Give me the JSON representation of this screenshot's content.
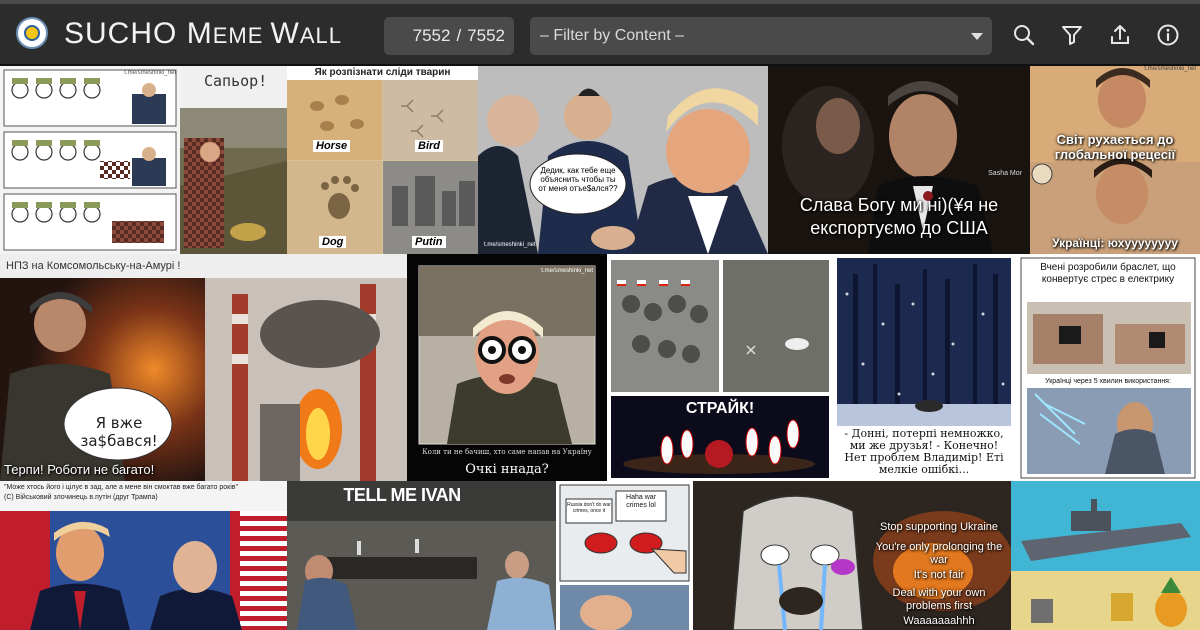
{
  "header": {
    "title_parts": [
      "S",
      "UCHO ",
      "M",
      "EME ",
      "W",
      "ALL"
    ],
    "counter_shown": "7552",
    "counter_sep": "/",
    "counter_total": "7552",
    "filter_label": "– Filter by Content –",
    "icons": [
      "search-icon",
      "filter-icon",
      "upload-icon",
      "info-icon"
    ]
  },
  "memes": {
    "watermark": "t.me/smeshinki_net",
    "sapor": "Сапьор!",
    "tracks_title": "Як розпізнати сліди тварин",
    "tracks_labels": [
      "Horse",
      "Bird",
      "Dog",
      "Putin"
    ],
    "putin_bubble": "Дедик, как тебе еще объяснить чтобы ты от меня отъе$ался??",
    "godfather_sig": "Sasha Mor",
    "godfather_caption": "Слава Богу ми ні)(¥я не експортуємо до США",
    "recession_top": "Світ рухається до глобальної рецесії",
    "recession_bottom": "Українці: юхуууууууу",
    "refinery_title": "НПЗ на Комсомольську-на-Амурі !",
    "refinery_bubble": "Я вже за$бався!",
    "refinery_bottom": "Терпи! Роботи не багато!",
    "glasses_caption": "Коли ти не бачиш, хто саме напав на Україну",
    "glasses_sub": "Очкі ннада?",
    "strike": "СТРАЙК!",
    "snow_caption": "- Донні, потерпі немножко, ми же друзья! - Конечно! Нет проблем Владимір! Еті мелкіе ошібкі...",
    "bracelet_top": "Вчені розробили браслет, що конвертує стрес в електрику",
    "bracelet_mid": "Українці через 5 хвилин використання:",
    "trump_quote": "\"Може хтось його і цілує в зад, але а мене він смоктав вже багато років\"",
    "trump_quote_sign": "(С) Військовий злочинець в.путін (друг Трампа)",
    "tell_me": "TELL ME IVAN",
    "button_left": "Russia don't do war crimes, once it",
    "button_right": "Haha war crimes lol",
    "wojak_lines": [
      "Stop supporting Ukraine",
      "You're only prolonging the war",
      "It's not fair",
      "Deal with your own problems first",
      "Waaaaaaahhh"
    ]
  },
  "colors": {
    "topbar": "#2c2c2c",
    "control": "#4a4a4a",
    "page": "#101010"
  }
}
